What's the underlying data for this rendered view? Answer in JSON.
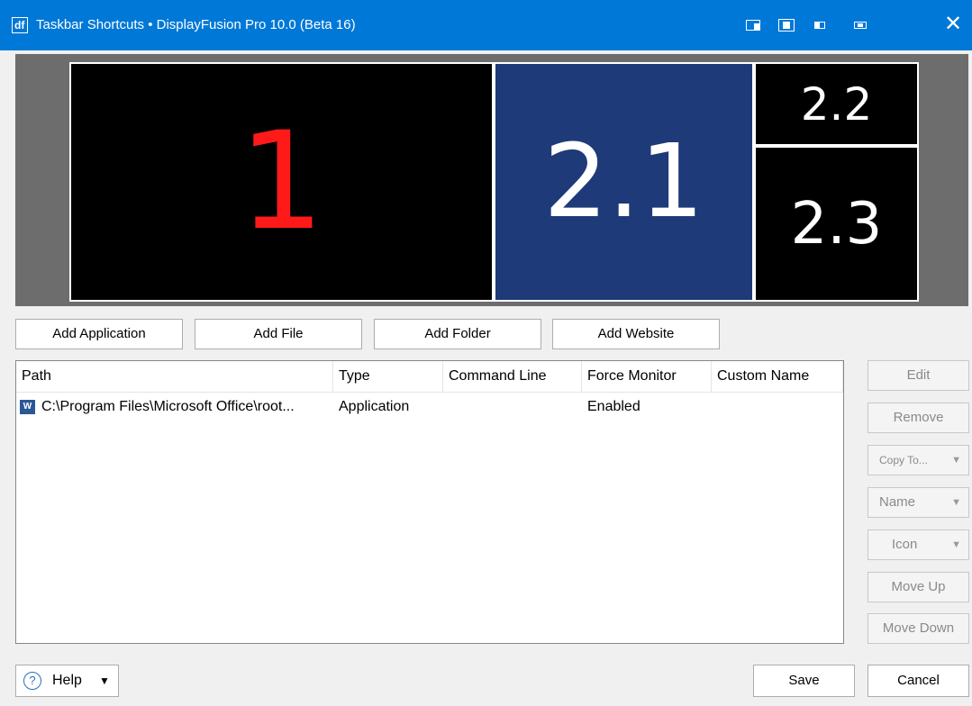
{
  "window": {
    "title": "Taskbar Shortcuts • DisplayFusion Pro 10.0 (Beta 16)",
    "app_icon_glyph": "df",
    "close_glyph": "✕"
  },
  "monitors": [
    {
      "label": "1"
    },
    {
      "label": "2.1"
    },
    {
      "label": "2.2"
    },
    {
      "label": "2.3"
    }
  ],
  "add_buttons": {
    "application": "Add Application",
    "file": "Add File",
    "folder": "Add Folder",
    "website": "Add Website"
  },
  "list": {
    "columns": [
      "Path",
      "Type",
      "Command Line",
      "Force Monitor",
      "Custom Name"
    ],
    "rows": [
      {
        "icon": "word-icon",
        "icon_glyph": "W",
        "path": "C:\\Program Files\\Microsoft Office\\root...",
        "type": "Application",
        "command_line": "",
        "force_monitor": "Enabled",
        "custom_name": ""
      }
    ]
  },
  "side_buttons": {
    "edit": "Edit",
    "remove": "Remove",
    "copy_to": "Copy To...",
    "name": "Name",
    "icon": "Icon",
    "move_up": "Move Up",
    "move_down": "Move Down",
    "dropdown_arrow": "▼"
  },
  "footer": {
    "help": "Help",
    "help_glyph": "?",
    "help_arrow": "▼",
    "save": "Save",
    "cancel": "Cancel"
  },
  "colors": {
    "titlebar": "#0078d7",
    "monitor_selected": "#1e3a78",
    "monitor_primary_text": "#ff1a1a"
  }
}
